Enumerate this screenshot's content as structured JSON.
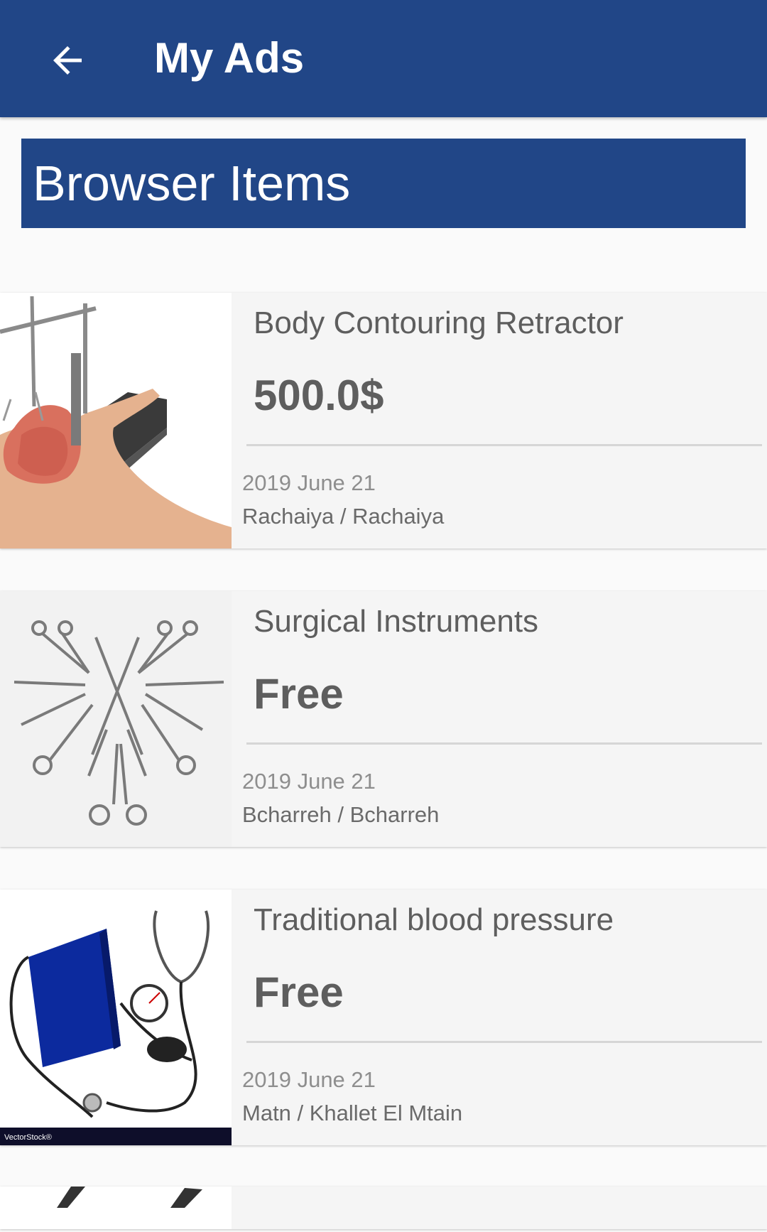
{
  "appbar": {
    "title": "My Ads",
    "back_icon": "arrow-left-icon"
  },
  "section": {
    "title": "Browser Items"
  },
  "items": [
    {
      "title": "Body Contouring Retractor",
      "price": "500.0$",
      "date": "2019 June 21",
      "location": "Rachaiya / Rachaiya",
      "image": "retractor-photo"
    },
    {
      "title": "Surgical Instruments",
      "price": "Free",
      "date": "2019 June 21",
      "location": "Bcharreh / Bcharreh",
      "image": "surgical-instruments-photo"
    },
    {
      "title": "Traditional blood pressure",
      "price": "Free",
      "date": "2019 June 21",
      "location": "Matn / Khallet El Mtain",
      "image": "blood-pressure-kit-photo",
      "image_caption": "VectorStock®"
    }
  ],
  "colors": {
    "primary": "#214687",
    "card_bg": "#f5f5f5",
    "text": "#5e5e5e"
  }
}
